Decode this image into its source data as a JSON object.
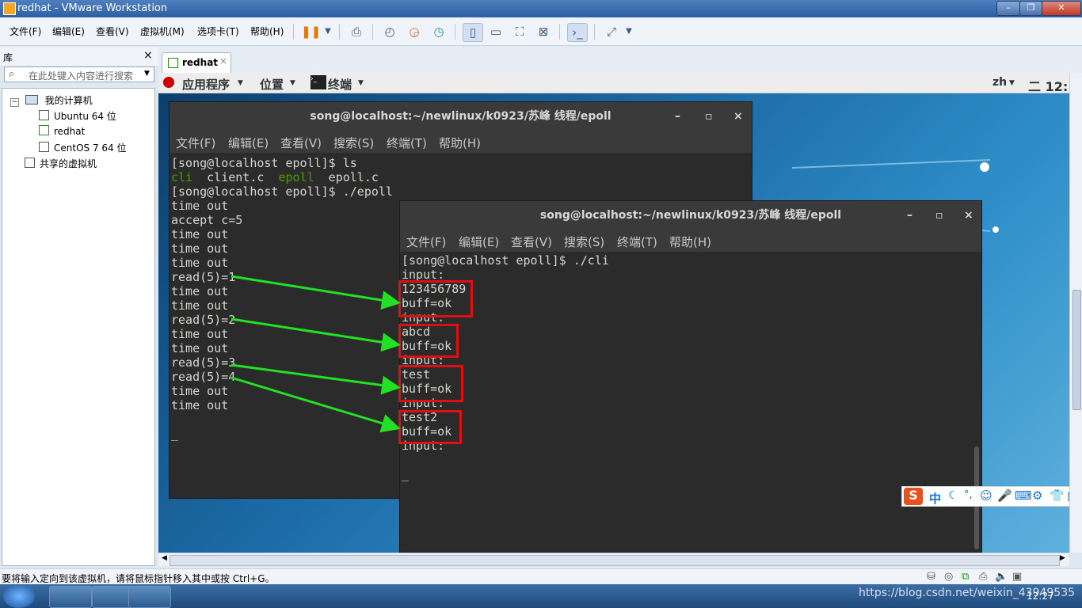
{
  "window": {
    "title": "redhat - VMware Workstation"
  },
  "menubar": {
    "items": [
      "文件(F)",
      "编辑(E)",
      "查看(V)",
      "虚拟机(M)",
      "选项卡(T)",
      "帮助(H)"
    ]
  },
  "library": {
    "title": "库",
    "close": "×",
    "search_placeholder": "在此处键入内容进行搜索",
    "tree": {
      "root": "我的计算机",
      "vms": [
        "Ubuntu 64 位",
        "redhat",
        "CentOS 7 64 位"
      ],
      "shared": "共享的虚拟机"
    }
  },
  "tabs": [
    {
      "label": "redhat",
      "close": "×"
    }
  ],
  "gnome": {
    "apps": "应用程序",
    "places": "位置",
    "terminal": "终端",
    "lang": "zh",
    "clock": "二 12:"
  },
  "term1": {
    "title": "song@localhost:~/newlinux/k0923/苏峰 线程/epoll",
    "menu": [
      "文件(F)",
      "编辑(E)",
      "查看(V)",
      "搜索(S)",
      "终端(T)",
      "帮助(H)"
    ],
    "ctl": [
      "–",
      "▫",
      "×"
    ],
    "lines": [
      "[song@localhost epoll]$ ls",
      "cli  client.c  epoll  epoll.c",
      "[song@localhost epoll]$ ./epoll",
      "time out",
      "accept c=5",
      "time out",
      "time out",
      "time out",
      "read(5)=1",
      "time out",
      "time out",
      "read(5)=2",
      "time out",
      "time out",
      "read(5)=3",
      "read(5)=4",
      "time out",
      "time out",
      "",
      "_"
    ],
    "ls_colored": {
      "cli": "cli",
      "epoll": "epoll",
      "rest1": "  client.c  ",
      "rest2": "  epoll.c"
    }
  },
  "term2": {
    "title": "song@localhost:~/newlinux/k0923/苏峰 线程/epoll",
    "menu": [
      "文件(F)",
      "编辑(E)",
      "查看(V)",
      "搜索(S)",
      "终端(T)",
      "帮助(H)"
    ],
    "ctl": [
      "–",
      "▫",
      "×"
    ],
    "lines": [
      "[song@localhost epoll]$ ./cli",
      "input:",
      "123456789",
      "buff=ok",
      "input:",
      "abcd",
      "buff=ok",
      "input:",
      "test",
      "buff=ok",
      "input:",
      "test2",
      "buff=ok",
      "input:",
      "",
      "_"
    ]
  },
  "ime": {
    "label": "中"
  },
  "status": {
    "text": "要将输入定向到该虚拟机，请将鼠标指针移入其中或按 Ctrl+G。"
  },
  "taskbar": {
    "clock": "12:27"
  },
  "watermark": "https://blog.csdn.net/weixin_43949535",
  "colors": {
    "term_bg": "#2b2b2b",
    "green_ls": "#4e9a06",
    "annot_red": "#e01010",
    "annot_green": "#22e022"
  }
}
